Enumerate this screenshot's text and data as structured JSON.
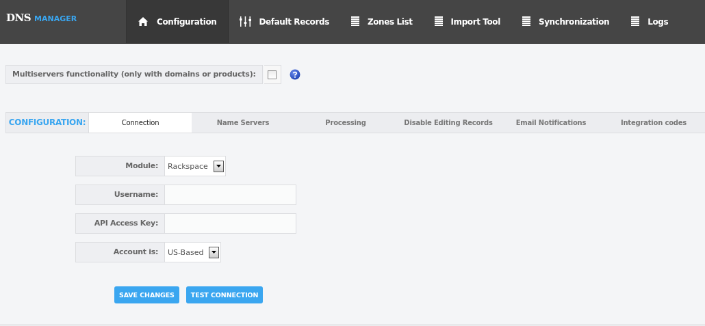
{
  "logo": {
    "main": "DNS",
    "sub": "MANAGER"
  },
  "nav": [
    {
      "label": "Configuration",
      "kind": "home",
      "selected": true
    },
    {
      "label": "Default Records",
      "kind": "sliders",
      "selected": false
    },
    {
      "label": "Zones List",
      "kind": "list",
      "selected": false
    },
    {
      "label": "Import Tool",
      "kind": "list",
      "selected": false
    },
    {
      "label": "Synchronization",
      "kind": "list",
      "selected": false
    },
    {
      "label": "Logs",
      "kind": "list",
      "selected": false
    }
  ],
  "multiservers": {
    "label": "Multiservers functionality (only with domains or products):",
    "checked": false
  },
  "config_tabs": {
    "title": "CONFIGURATION:",
    "tabs": [
      {
        "label": "Connection",
        "selected": true
      },
      {
        "label": "Name Servers",
        "selected": false
      },
      {
        "label": "Processing",
        "selected": false
      },
      {
        "label": "Disable Editing Records",
        "selected": false
      },
      {
        "label": "Email Notifications",
        "selected": false
      },
      {
        "label": "Integration codes",
        "selected": false
      }
    ]
  },
  "form": [
    {
      "label": "Module:",
      "kind": "select",
      "value": "Rackspace"
    },
    {
      "label": "Username:",
      "kind": "text"
    },
    {
      "label": "API Access Key:",
      "kind": "text"
    },
    {
      "label": "Account is:",
      "kind": "select",
      "value": "US-Based"
    }
  ],
  "buttons": [
    "SAVE CHANGES",
    "TEST CONNECTION"
  ]
}
